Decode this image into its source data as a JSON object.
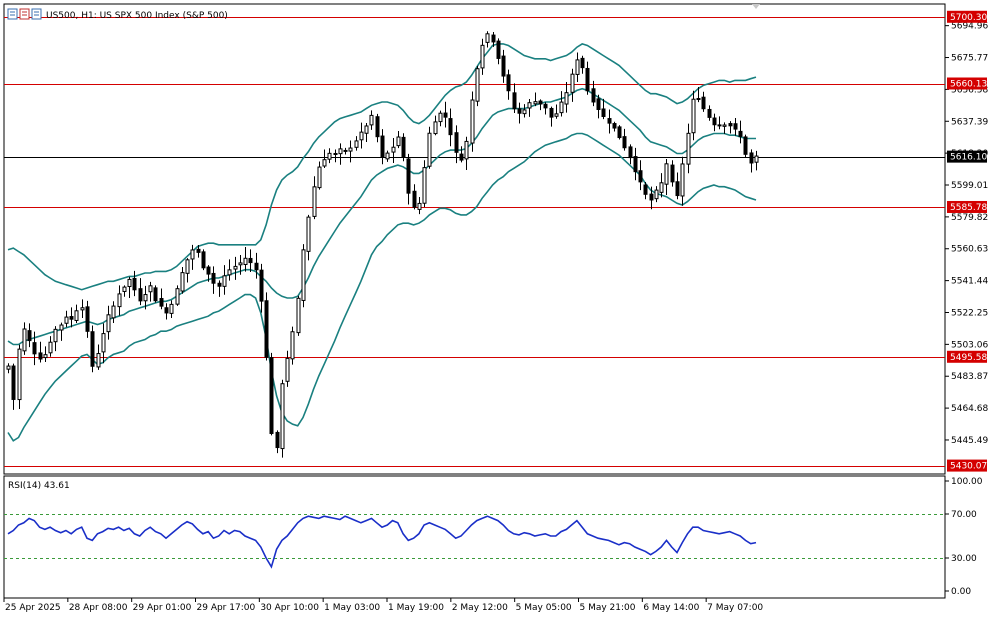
{
  "header": {
    "symbol_title": "US500, H1:  US SPX 500 Index (S&P 500)",
    "rsi_title": "RSI(14) 43.61"
  },
  "colors": {
    "candle": "#000000",
    "bollinger": "#1a8080",
    "level_line": "#d40000",
    "level_tag": "#d40000",
    "current_tag": "#000000",
    "rsi_line": "#1a2fc8",
    "rsi_level": "#3a9a3a"
  },
  "chart_data": [
    {
      "type": "candlestick",
      "title": "US500, H1:  US SPX 500 Index (S&P 500)",
      "ylim": [
        5425,
        5708
      ],
      "yticks": [
        "5694.96",
        "5675.77",
        "5656.58",
        "5637.39",
        "5618.20",
        "5599.01",
        "5579.82",
        "5560.63",
        "5541.44",
        "5522.25",
        "5503.06",
        "5483.87",
        "5464.68",
        "5445.49"
      ],
      "xticks": [
        "25 Apr 2025",
        "28 Apr 08:00",
        "29 Apr 01:00",
        "29 Apr 17:00",
        "30 Apr 10:00",
        "1 May 03:00",
        "1 May 19:00",
        "2 May 12:00",
        "5 May 05:00",
        "5 May 21:00",
        "6 May 14:00",
        "7 May 07:00"
      ],
      "levels": [
        {
          "label": "5700.30",
          "value": 5700.3
        },
        {
          "label": "5660.13",
          "value": 5660.13
        },
        {
          "label": "5585.78",
          "value": 5585.78
        },
        {
          "label": "5495.58",
          "value": 5495.58
        },
        {
          "label": "5430.07",
          "value": 5430.07
        }
      ],
      "current_price": {
        "label": "5616.10",
        "value": 5616.1
      },
      "indicator": "Bollinger Bands",
      "close_path": [
        5490,
        5470,
        5500,
        5512,
        5505,
        5498,
        5495,
        5497,
        5505,
        5512,
        5515,
        5520,
        5518,
        5524,
        5526,
        5510,
        5490,
        5498,
        5510,
        5520,
        5526,
        5534,
        5538,
        5542,
        5536,
        5530,
        5534,
        5538,
        5530,
        5526,
        5522,
        5528,
        5536,
        5546,
        5554,
        5560,
        5558,
        5550,
        5546,
        5540,
        5538,
        5544,
        5548,
        5550,
        5552,
        5555,
        5552,
        5548,
        5530,
        5495,
        5450,
        5440,
        5480,
        5495,
        5510,
        5530,
        5560,
        5580,
        5598,
        5610,
        5615,
        5618,
        5617,
        5620,
        5619,
        5622,
        5626,
        5630,
        5635,
        5640,
        5628,
        5615,
        5618,
        5622,
        5628,
        5615,
        5595,
        5585,
        5588,
        5610,
        5630,
        5638,
        5642,
        5640,
        5630,
        5618,
        5615,
        5625,
        5650,
        5670,
        5684,
        5690,
        5686,
        5676,
        5665,
        5655,
        5645,
        5642,
        5645,
        5648,
        5650,
        5648,
        5645,
        5640,
        5642,
        5648,
        5655,
        5665,
        5675,
        5670,
        5656,
        5650,
        5645,
        5640,
        5637,
        5633,
        5628,
        5622,
        5616,
        5608,
        5600,
        5593,
        5590,
        5595,
        5600,
        5612,
        5600,
        5592,
        5612,
        5630,
        5650,
        5652,
        5645,
        5640,
        5636,
        5635,
        5636,
        5635,
        5632,
        5628,
        5618,
        5612,
        5616
      ],
      "bb_mid_path": [
        5505,
        5503,
        5503,
        5505,
        5506,
        5507,
        5508,
        5509,
        5510,
        5511,
        5512,
        5513,
        5514,
        5515,
        5516,
        5517,
        5516,
        5515,
        5516,
        5518,
        5519,
        5520,
        5521,
        5523,
        5524,
        5525,
        5526,
        5527,
        5528,
        5529,
        5529,
        5530,
        5532,
        5534,
        5536,
        5538,
        5540,
        5541,
        5542,
        5543,
        5543,
        5544,
        5545,
        5546,
        5547,
        5548,
        5548,
        5547,
        5544,
        5541,
        5537,
        5534,
        5532,
        5531,
        5531,
        5532,
        5537,
        5543,
        5550,
        5556,
        5561,
        5566,
        5571,
        5576,
        5580,
        5584,
        5588,
        5592,
        5597,
        5602,
        5605,
        5607,
        5609,
        5610,
        5611,
        5610,
        5608,
        5606,
        5606,
        5608,
        5611,
        5614,
        5617,
        5619,
        5620,
        5620,
        5620,
        5621,
        5624,
        5628,
        5633,
        5637,
        5641,
        5643,
        5644,
        5645,
        5645,
        5645,
        5645,
        5646,
        5647,
        5648,
        5649,
        5649,
        5650,
        5651,
        5652,
        5654,
        5656,
        5657,
        5656,
        5654,
        5652,
        5650,
        5648,
        5646,
        5644,
        5641,
        5638,
        5635,
        5632,
        5628,
        5625,
        5624,
        5623,
        5622,
        5620,
        5618,
        5618,
        5620,
        5623,
        5626,
        5628,
        5629,
        5630,
        5630,
        5630,
        5629,
        5629,
        5628,
        5627,
        5627,
        5627
      ],
      "bb_width_path": [
        55,
        58,
        56,
        52,
        48,
        44,
        40,
        36,
        33,
        30,
        28,
        26,
        24,
        22,
        20,
        20,
        22,
        24,
        24,
        23,
        22,
        22,
        22,
        21,
        20,
        20,
        20,
        19,
        19,
        18,
        18,
        18,
        18,
        19,
        20,
        21,
        22,
        22,
        22,
        21,
        20,
        19,
        18,
        17,
        16,
        15,
        15,
        16,
        22,
        34,
        50,
        62,
        70,
        74,
        76,
        78,
        78,
        76,
        74,
        72,
        70,
        68,
        66,
        63,
        60,
        57,
        54,
        51,
        48,
        45,
        43,
        42,
        40,
        38,
        36,
        34,
        32,
        31,
        30,
        30,
        30,
        31,
        32,
        34,
        36,
        38,
        39,
        40,
        41,
        42,
        42,
        42,
        42,
        41,
        40,
        38,
        36,
        34,
        32,
        30,
        28,
        27,
        26,
        25,
        25,
        25,
        25,
        25,
        26,
        27,
        27,
        27,
        27,
        27,
        27,
        27,
        27,
        27,
        27,
        27,
        27,
        28,
        29,
        30,
        30,
        30,
        30,
        30,
        31,
        31,
        31,
        31,
        31,
        31,
        31,
        32,
        32,
        32,
        33,
        34,
        35,
        36,
        37
      ]
    },
    {
      "type": "line",
      "title": "RSI(14) 43.61",
      "ylim": [
        0,
        100
      ],
      "yticks": [
        "100.00",
        "70.00",
        "30.00",
        "0.00"
      ],
      "levels": [
        70,
        30
      ],
      "values": [
        52,
        55,
        60,
        62,
        66,
        64,
        58,
        56,
        58,
        55,
        53,
        55,
        52,
        56,
        58,
        48,
        46,
        52,
        54,
        57,
        56,
        58,
        55,
        57,
        52,
        50,
        55,
        58,
        54,
        52,
        48,
        52,
        56,
        60,
        63,
        61,
        56,
        52,
        54,
        48,
        50,
        55,
        52,
        55,
        54,
        50,
        48,
        46,
        40,
        30,
        22,
        38,
        46,
        50,
        56,
        62,
        66,
        68,
        67,
        66,
        68,
        67,
        66,
        65,
        68,
        66,
        64,
        62,
        64,
        66,
        62,
        58,
        60,
        64,
        62,
        52,
        46,
        48,
        52,
        60,
        62,
        60,
        58,
        56,
        52,
        48,
        50,
        55,
        60,
        64,
        66,
        68,
        66,
        64,
        60,
        55,
        52,
        51,
        53,
        52,
        50,
        51,
        52,
        50,
        50,
        54,
        56,
        60,
        64,
        58,
        52,
        50,
        48,
        47,
        46,
        44,
        42,
        44,
        43,
        40,
        38,
        36,
        33,
        36,
        40,
        46,
        40,
        35,
        44,
        52,
        58,
        58,
        55,
        54,
        53,
        52,
        53,
        54,
        52,
        50,
        46,
        43,
        44
      ]
    }
  ]
}
